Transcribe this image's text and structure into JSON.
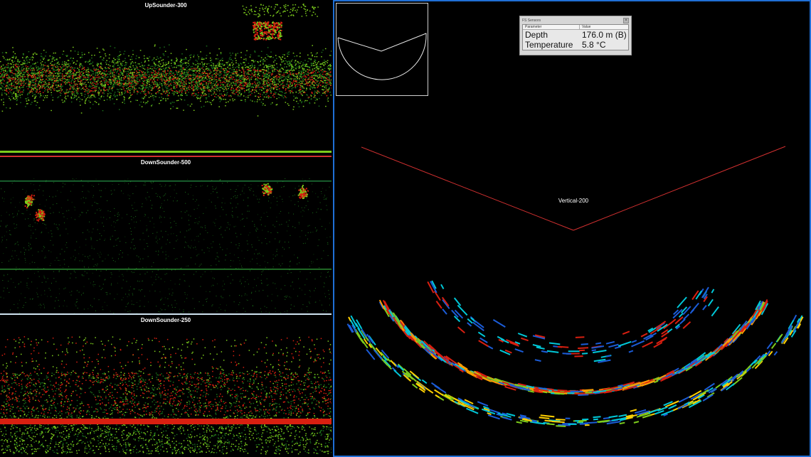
{
  "panels": {
    "up": {
      "title": "UpSounder-300"
    },
    "down500": {
      "title": "DownSounder-500"
    },
    "down250": {
      "title": "DownSounder-250"
    },
    "vertical": {
      "title": "Vertical-200"
    }
  },
  "sensor_popup": {
    "title": "FS Sensors",
    "close_glyph": "×",
    "columns": [
      "Parameter",
      "Value"
    ],
    "rows": [
      {
        "parameter": "Depth",
        "value": "176.0 m (B)"
      },
      {
        "parameter": "Temperature",
        "value": "5.8 °C"
      }
    ]
  },
  "colors": {
    "divider_red": "#d23030",
    "divider_light": "#cfe3f0",
    "selection_border": "#1f6fd6",
    "echo_low": "#1a6f1a",
    "echo_mid": "#7ccc1c",
    "echo_high": "#d81f10",
    "echo_cool": "#1b5cd8",
    "echo_cyan": "#00c8d8"
  }
}
